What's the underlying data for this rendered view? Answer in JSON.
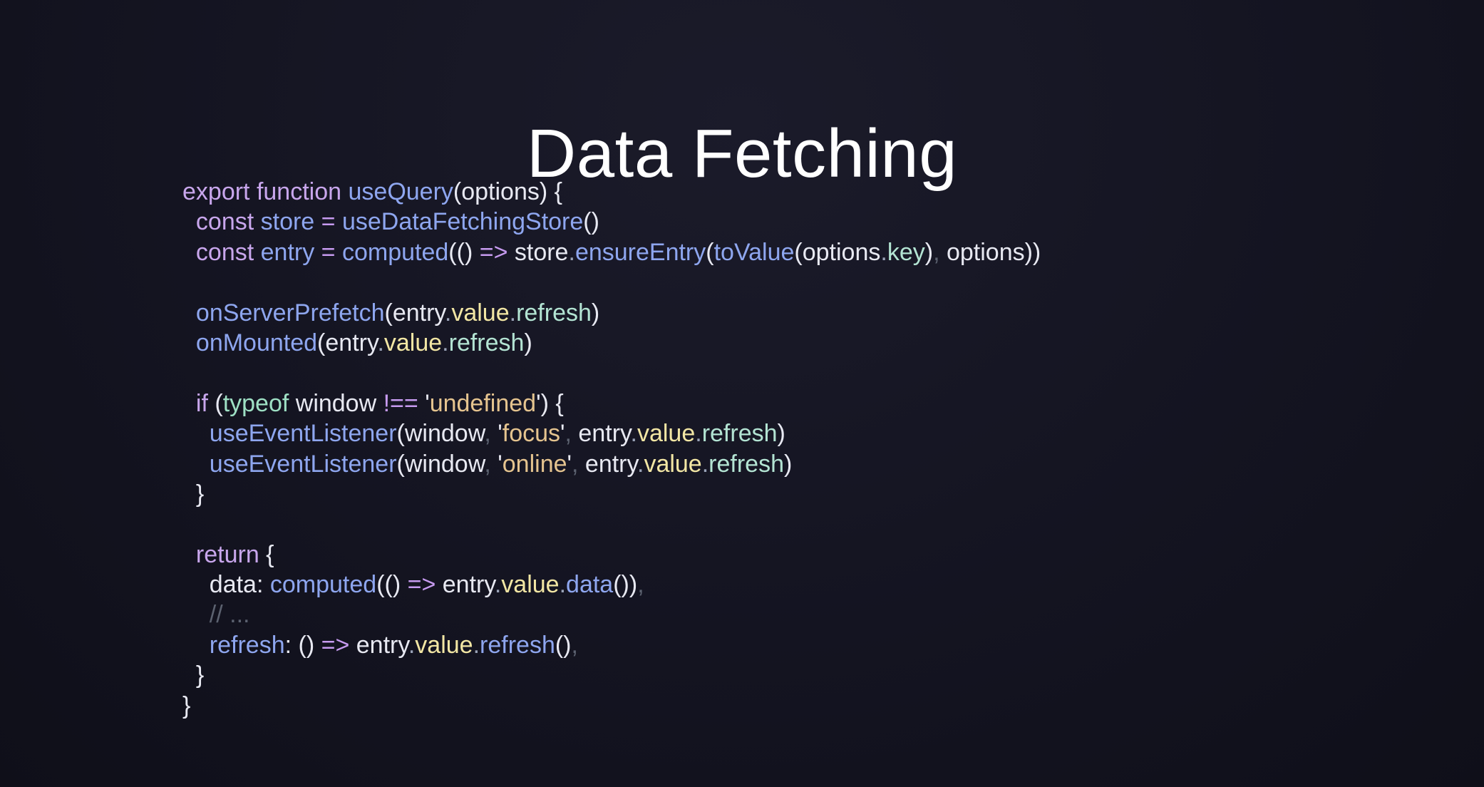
{
  "slide": {
    "title": "Data Fetching"
  },
  "code": {
    "language": "javascript",
    "lines": [
      [
        {
          "t": "export",
          "c": "kw"
        },
        {
          "t": " ",
          "c": "id"
        },
        {
          "t": "function",
          "c": "kw"
        },
        {
          "t": " ",
          "c": "id"
        },
        {
          "t": "useQuery",
          "c": "fn"
        },
        {
          "t": "(options) {",
          "c": "id"
        }
      ],
      [
        {
          "t": "  ",
          "c": "id"
        },
        {
          "t": "const",
          "c": "kw"
        },
        {
          "t": " ",
          "c": "id"
        },
        {
          "t": "store",
          "c": "fn"
        },
        {
          "t": " = ",
          "c": "op"
        },
        {
          "t": "useDataFetchingStore",
          "c": "fn"
        },
        {
          "t": "()",
          "c": "pu"
        }
      ],
      [
        {
          "t": "  ",
          "c": "id"
        },
        {
          "t": "const",
          "c": "kw"
        },
        {
          "t": " ",
          "c": "id"
        },
        {
          "t": "entry",
          "c": "fn"
        },
        {
          "t": " = ",
          "c": "op"
        },
        {
          "t": "computed",
          "c": "fn"
        },
        {
          "t": "(() ",
          "c": "pu"
        },
        {
          "t": "=>",
          "c": "op"
        },
        {
          "t": " store",
          "c": "id"
        },
        {
          "t": ".",
          "c": "dt"
        },
        {
          "t": "ensureEntry",
          "c": "fn"
        },
        {
          "t": "(",
          "c": "pu"
        },
        {
          "t": "toValue",
          "c": "fn"
        },
        {
          "t": "(options",
          "c": "id"
        },
        {
          "t": ".",
          "c": "dt"
        },
        {
          "t": "key",
          "c": "pr"
        },
        {
          "t": ")",
          "c": "pu"
        },
        {
          "t": ",",
          "c": "cm"
        },
        {
          "t": " options))",
          "c": "id"
        }
      ],
      [],
      [
        {
          "t": "  ",
          "c": "id"
        },
        {
          "t": "onServerPrefetch",
          "c": "fn"
        },
        {
          "t": "(entry",
          "c": "id"
        },
        {
          "t": ".",
          "c": "dt"
        },
        {
          "t": "value",
          "c": "vl"
        },
        {
          "t": ".",
          "c": "dt"
        },
        {
          "t": "refresh",
          "c": "pr"
        },
        {
          "t": ")",
          "c": "pu"
        }
      ],
      [
        {
          "t": "  ",
          "c": "id"
        },
        {
          "t": "onMounted",
          "c": "fn"
        },
        {
          "t": "(entry",
          "c": "id"
        },
        {
          "t": ".",
          "c": "dt"
        },
        {
          "t": "value",
          "c": "vl"
        },
        {
          "t": ".",
          "c": "dt"
        },
        {
          "t": "refresh",
          "c": "pr"
        },
        {
          "t": ")",
          "c": "pu"
        }
      ],
      [],
      [
        {
          "t": "  ",
          "c": "id"
        },
        {
          "t": "if",
          "c": "kw"
        },
        {
          "t": " (",
          "c": "pu"
        },
        {
          "t": "typeof",
          "c": "ty"
        },
        {
          "t": " window ",
          "c": "id"
        },
        {
          "t": "!==",
          "c": "op"
        },
        {
          "t": " '",
          "c": "id"
        },
        {
          "t": "undefined",
          "c": "st"
        },
        {
          "t": "') {",
          "c": "id"
        }
      ],
      [
        {
          "t": "    ",
          "c": "id"
        },
        {
          "t": "useEventListener",
          "c": "fn"
        },
        {
          "t": "(window",
          "c": "id"
        },
        {
          "t": ",",
          "c": "cm"
        },
        {
          "t": " '",
          "c": "id"
        },
        {
          "t": "focus",
          "c": "st"
        },
        {
          "t": "'",
          "c": "id"
        },
        {
          "t": ",",
          "c": "cm"
        },
        {
          "t": " entry",
          "c": "id"
        },
        {
          "t": ".",
          "c": "dt"
        },
        {
          "t": "value",
          "c": "vl"
        },
        {
          "t": ".",
          "c": "dt"
        },
        {
          "t": "refresh",
          "c": "pr"
        },
        {
          "t": ")",
          "c": "pu"
        }
      ],
      [
        {
          "t": "    ",
          "c": "id"
        },
        {
          "t": "useEventListener",
          "c": "fn"
        },
        {
          "t": "(window",
          "c": "id"
        },
        {
          "t": ",",
          "c": "cm"
        },
        {
          "t": " '",
          "c": "id"
        },
        {
          "t": "online",
          "c": "st"
        },
        {
          "t": "'",
          "c": "id"
        },
        {
          "t": ",",
          "c": "cm"
        },
        {
          "t": " entry",
          "c": "id"
        },
        {
          "t": ".",
          "c": "dt"
        },
        {
          "t": "value",
          "c": "vl"
        },
        {
          "t": ".",
          "c": "dt"
        },
        {
          "t": "refresh",
          "c": "pr"
        },
        {
          "t": ")",
          "c": "pu"
        }
      ],
      [
        {
          "t": "  }",
          "c": "pu"
        }
      ],
      [],
      [
        {
          "t": "  ",
          "c": "id"
        },
        {
          "t": "return",
          "c": "kw"
        },
        {
          "t": " {",
          "c": "pu"
        }
      ],
      [
        {
          "t": "    data: ",
          "c": "id"
        },
        {
          "t": "computed",
          "c": "fn"
        },
        {
          "t": "(() ",
          "c": "pu"
        },
        {
          "t": "=>",
          "c": "op"
        },
        {
          "t": " entry",
          "c": "id"
        },
        {
          "t": ".",
          "c": "dt"
        },
        {
          "t": "value",
          "c": "vl"
        },
        {
          "t": ".",
          "c": "dt"
        },
        {
          "t": "data",
          "c": "fn"
        },
        {
          "t": "())",
          "c": "pu"
        },
        {
          "t": ",",
          "c": "cm"
        }
      ],
      [
        {
          "t": "    // ...",
          "c": "cm"
        }
      ],
      [
        {
          "t": "    ",
          "c": "id"
        },
        {
          "t": "refresh",
          "c": "fn"
        },
        {
          "t": ": () ",
          "c": "id"
        },
        {
          "t": "=>",
          "c": "op"
        },
        {
          "t": " entry",
          "c": "id"
        },
        {
          "t": ".",
          "c": "dt"
        },
        {
          "t": "value",
          "c": "vl"
        },
        {
          "t": ".",
          "c": "dt"
        },
        {
          "t": "refresh",
          "c": "fn"
        },
        {
          "t": "()",
          "c": "pu"
        },
        {
          "t": ",",
          "c": "cm"
        }
      ],
      [
        {
          "t": "  }",
          "c": "pu"
        }
      ],
      [
        {
          "t": "}",
          "c": "pu"
        }
      ]
    ]
  }
}
